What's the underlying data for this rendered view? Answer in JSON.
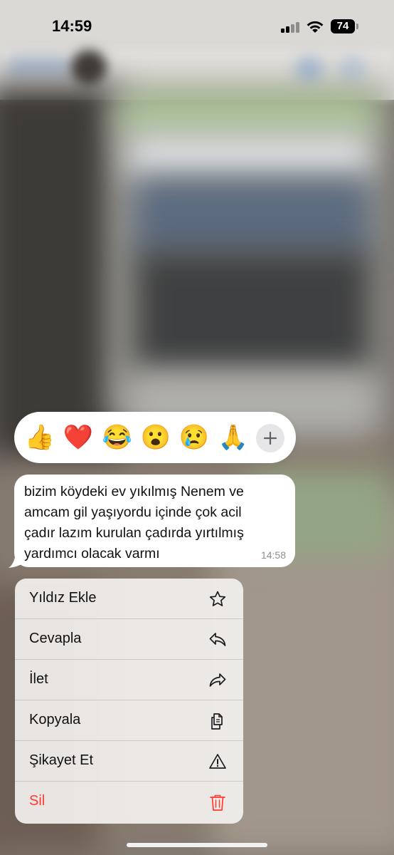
{
  "status_bar": {
    "time": "14:59",
    "battery": "74",
    "icons": [
      "signal-icon",
      "wifi-icon",
      "battery-icon"
    ]
  },
  "reactions": {
    "items": [
      {
        "name": "thumbs-up",
        "emoji": "👍"
      },
      {
        "name": "heart",
        "emoji": "❤️"
      },
      {
        "name": "tears-of-joy",
        "emoji": "😂"
      },
      {
        "name": "surprised",
        "emoji": "😮"
      },
      {
        "name": "crying",
        "emoji": "😢"
      },
      {
        "name": "folded-hands",
        "emoji": "🙏"
      }
    ],
    "more_icon": "plus-icon"
  },
  "message": {
    "text": "bizim köydeki ev yıkılmış Nenem ve\namcam gil yaşıyordu içinde  çok acil\nçadır lazım kurulan çadırda  yırtılmış\nyardımcı olacak varmı",
    "time": "14:58"
  },
  "menu": {
    "items": [
      {
        "label": "Yıldız Ekle",
        "icon": "star-icon"
      },
      {
        "label": "Cevapla",
        "icon": "reply-icon"
      },
      {
        "label": "İlet",
        "icon": "forward-icon"
      },
      {
        "label": "Kopyala",
        "icon": "copy-icon"
      },
      {
        "label": "Şikayet Et",
        "icon": "warning-icon"
      },
      {
        "label": "Sil",
        "icon": "trash-icon",
        "destructive": true
      }
    ]
  },
  "colors": {
    "destructive": "#ff3b30",
    "bubble": "#ffffff",
    "menu_background": "#f2f0ee"
  }
}
